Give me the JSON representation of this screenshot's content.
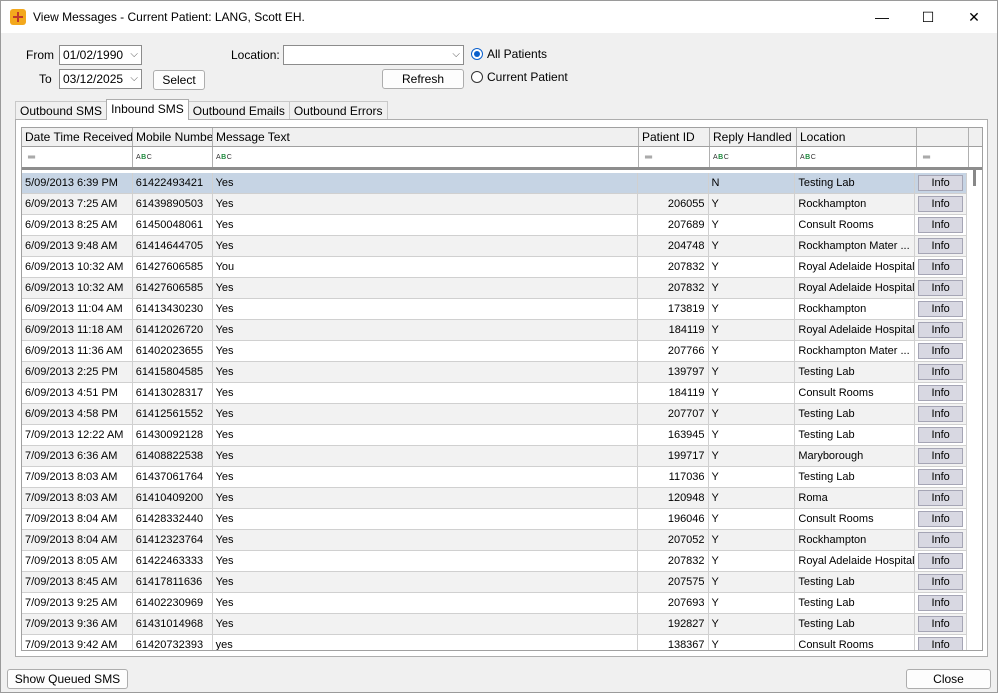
{
  "window": {
    "title": "View Messages  -  Current Patient: LANG, Scott EH.",
    "minimize": "—",
    "maximize": "☐",
    "close": "✕"
  },
  "filters": {
    "from_label": "From",
    "from_value": "01/02/1990",
    "to_label": "To",
    "to_value": "03/12/2025",
    "select_label": "Select",
    "location_label": "Location:",
    "location_value": "",
    "refresh_label": "Refresh",
    "radio_all": "All Patients",
    "radio_current": "Current Patient",
    "selected_radio": "All Patients"
  },
  "tabs": [
    "Outbound SMS",
    "Inbound SMS",
    "Outbound Emails",
    "Outbound Errors"
  ],
  "active_tab": "Inbound SMS",
  "columns": [
    "Date Time Received",
    "Mobile Number",
    "Message Text",
    "Patient ID",
    "Reply Handled",
    "Location",
    ""
  ],
  "info_label": "Info",
  "rows": [
    {
      "dt": "5/09/2013 6:39 PM",
      "mob": "61422493421",
      "msg": "Yes",
      "pid": "",
      "rep": "N",
      "loc": "Testing Lab"
    },
    {
      "dt": "6/09/2013 7:25 AM",
      "mob": "61439890503",
      "msg": "Yes",
      "pid": "206055",
      "rep": "Y",
      "loc": "Rockhampton"
    },
    {
      "dt": "6/09/2013 8:25 AM",
      "mob": "61450048061",
      "msg": "Yes",
      "pid": "207689",
      "rep": "Y",
      "loc": "Consult Rooms"
    },
    {
      "dt": "6/09/2013 9:48 AM",
      "mob": "61414644705",
      "msg": "Yes",
      "pid": "204748",
      "rep": "Y",
      "loc": "Rockhampton Mater ..."
    },
    {
      "dt": "6/09/2013 10:32 AM",
      "mob": "61427606585",
      "msg": "You",
      "pid": "207832",
      "rep": "Y",
      "loc": "Royal Adelaide Hospital"
    },
    {
      "dt": "6/09/2013 10:32 AM",
      "mob": "61427606585",
      "msg": "Yes",
      "pid": "207832",
      "rep": "Y",
      "loc": "Royal Adelaide Hospital"
    },
    {
      "dt": "6/09/2013 11:04 AM",
      "mob": "61413430230",
      "msg": "Yes",
      "pid": "173819",
      "rep": "Y",
      "loc": "Rockhampton"
    },
    {
      "dt": "6/09/2013 11:18 AM",
      "mob": "61412026720",
      "msg": "Yes",
      "pid": "184119",
      "rep": "Y",
      "loc": "Royal Adelaide Hospital"
    },
    {
      "dt": "6/09/2013 11:36 AM",
      "mob": "61402023655",
      "msg": "Yes",
      "pid": "207766",
      "rep": "Y",
      "loc": "Rockhampton Mater ..."
    },
    {
      "dt": "6/09/2013 2:25 PM",
      "mob": "61415804585",
      "msg": "Yes",
      "pid": "139797",
      "rep": "Y",
      "loc": "Testing Lab"
    },
    {
      "dt": "6/09/2013 4:51 PM",
      "mob": "61413028317",
      "msg": "Yes",
      "pid": "184119",
      "rep": "Y",
      "loc": "Consult Rooms"
    },
    {
      "dt": "6/09/2013 4:58 PM",
      "mob": "61412561552",
      "msg": "Yes",
      "pid": "207707",
      "rep": "Y",
      "loc": "Testing Lab"
    },
    {
      "dt": "7/09/2013 12:22 AM",
      "mob": "61430092128",
      "msg": "Yes",
      "pid": "163945",
      "rep": "Y",
      "loc": "Testing Lab"
    },
    {
      "dt": "7/09/2013 6:36 AM",
      "mob": "61408822538",
      "msg": "Yes",
      "pid": "199717",
      "rep": "Y",
      "loc": "Maryborough"
    },
    {
      "dt": "7/09/2013 8:03 AM",
      "mob": "61437061764",
      "msg": "Yes",
      "pid": "117036",
      "rep": "Y",
      "loc": "Testing Lab"
    },
    {
      "dt": "7/09/2013 8:03 AM",
      "mob": "61410409200",
      "msg": "Yes",
      "pid": "120948",
      "rep": "Y",
      "loc": "Roma"
    },
    {
      "dt": "7/09/2013 8:04 AM",
      "mob": "61428332440",
      "msg": "Yes",
      "pid": "196046",
      "rep": "Y",
      "loc": "Consult Rooms"
    },
    {
      "dt": "7/09/2013 8:04 AM",
      "mob": "61412323764",
      "msg": "Yes",
      "pid": "207052",
      "rep": "Y",
      "loc": "Rockhampton"
    },
    {
      "dt": "7/09/2013 8:05 AM",
      "mob": "61422463333",
      "msg": "Yes",
      "pid": "207832",
      "rep": "Y",
      "loc": "Royal Adelaide Hospital"
    },
    {
      "dt": "7/09/2013 8:45 AM",
      "mob": "61417811636",
      "msg": "Yes",
      "pid": "207575",
      "rep": "Y",
      "loc": "Testing Lab"
    },
    {
      "dt": "7/09/2013 9:25 AM",
      "mob": "61402230969",
      "msg": "Yes",
      "pid": "207693",
      "rep": "Y",
      "loc": "Testing Lab"
    },
    {
      "dt": "7/09/2013 9:36 AM",
      "mob": "61431014968",
      "msg": "Yes",
      "pid": "192827",
      "rep": "Y",
      "loc": "Testing Lab"
    },
    {
      "dt": "7/09/2013 9:42 AM",
      "mob": "61420732393",
      "msg": "yes",
      "pid": "138367",
      "rep": "Y",
      "loc": "Consult Rooms"
    }
  ],
  "footer": {
    "show_queued_label": "Show Queued SMS",
    "close_label": "Close"
  }
}
